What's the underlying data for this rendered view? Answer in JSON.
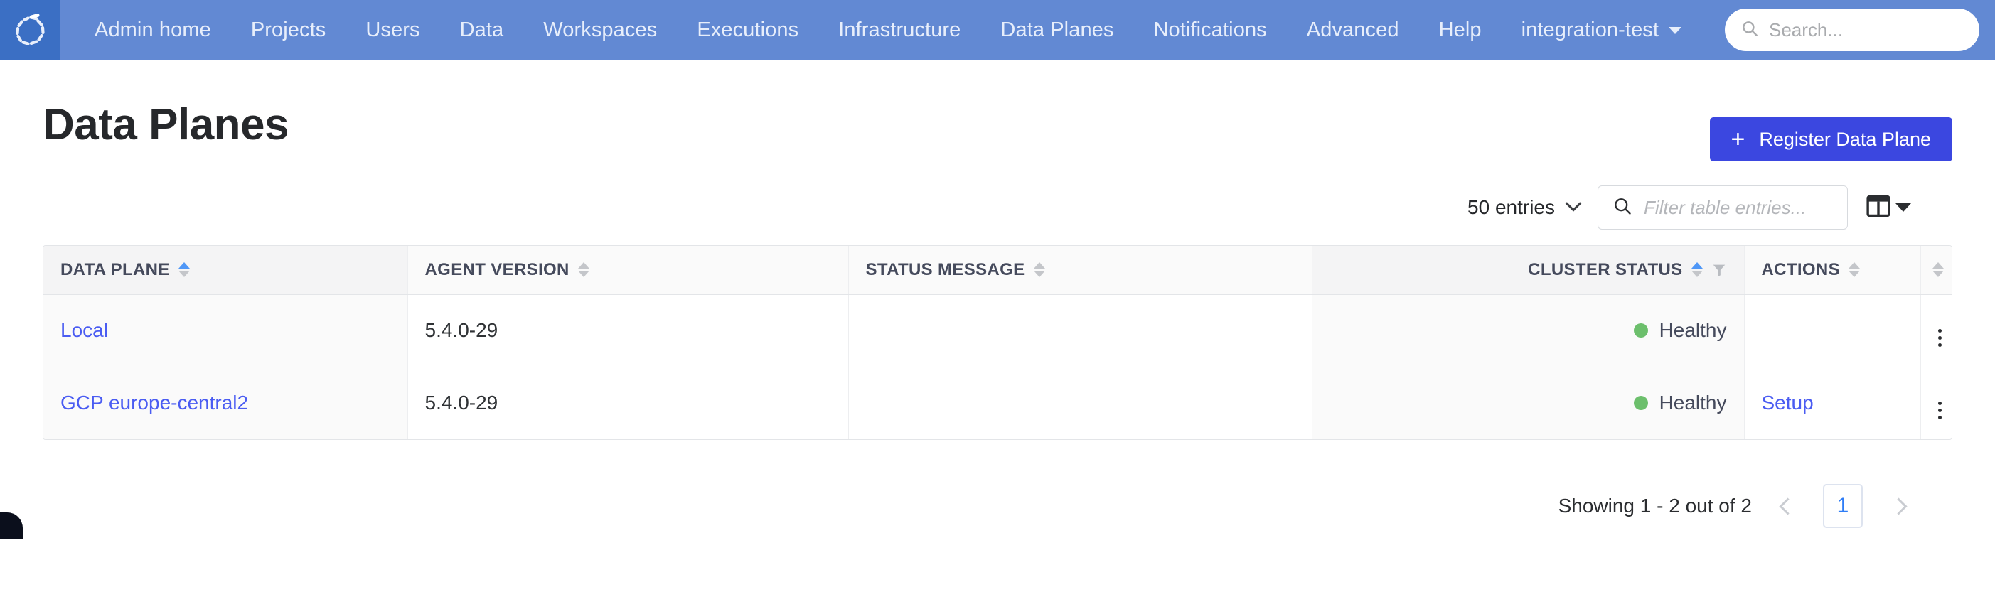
{
  "navbar": {
    "logo_icon": "seqera-spinner-logo",
    "items": [
      {
        "label": "Admin home",
        "caret": false
      },
      {
        "label": "Projects",
        "caret": false
      },
      {
        "label": "Users",
        "caret": false
      },
      {
        "label": "Data",
        "caret": false
      },
      {
        "label": "Workspaces",
        "caret": false
      },
      {
        "label": "Executions",
        "caret": false
      },
      {
        "label": "Infrastructure",
        "caret": false
      },
      {
        "label": "Data Planes",
        "caret": false
      },
      {
        "label": "Notifications",
        "caret": false
      },
      {
        "label": "Advanced",
        "caret": false
      },
      {
        "label": "Help",
        "caret": false
      },
      {
        "label": "integration-test",
        "caret": true
      }
    ],
    "search": {
      "placeholder": "Search...",
      "value": "",
      "icon": "search-icon"
    }
  },
  "header": {
    "title": "Data Planes",
    "register_button": {
      "label": "Register Data Plane",
      "icon": "plus-icon"
    }
  },
  "toolbar": {
    "entries": {
      "label": "50 entries",
      "icon": "chevron-down-icon"
    },
    "filter": {
      "placeholder": "Filter table entries...",
      "value": "",
      "icon": "search-icon"
    },
    "columns_button": {
      "icon": "columns-settings-icon"
    }
  },
  "table": {
    "columns": [
      {
        "key": "data_plane",
        "label": "DATA PLANE",
        "align": "left",
        "sort": "asc",
        "sorted": true,
        "filter": false
      },
      {
        "key": "agent_version",
        "label": "AGENT VERSION",
        "align": "left",
        "sort": "none",
        "sorted": false,
        "filter": false
      },
      {
        "key": "status_message",
        "label": "STATUS MESSAGE",
        "align": "left",
        "sort": "none",
        "sorted": false,
        "filter": false
      },
      {
        "key": "cluster_status",
        "label": "CLUSTER STATUS",
        "align": "right",
        "sort": "asc",
        "sorted": true,
        "filter": true
      },
      {
        "key": "actions",
        "label": "ACTIONS",
        "align": "left",
        "sort": "none",
        "sorted": false,
        "filter": false
      },
      {
        "key": "menu",
        "label": "",
        "align": "center",
        "sort": "none",
        "sorted": false,
        "filter": false
      }
    ],
    "rows": [
      {
        "data_plane": "Local",
        "agent_version": "5.4.0-29",
        "status_message": "",
        "cluster_status": "Healthy",
        "cluster_status_color": "#6cbf6c",
        "actions": "",
        "menu_icon": "kebab-menu-icon"
      },
      {
        "data_plane": "GCP europe-central2",
        "agent_version": "5.4.0-29",
        "status_message": "",
        "cluster_status": "Healthy",
        "cluster_status_color": "#6cbf6c",
        "actions": "Setup",
        "menu_icon": "kebab-menu-icon"
      }
    ]
  },
  "pagination": {
    "showing": "Showing 1 - 2 out of 2",
    "prev_icon": "chevron-left-icon",
    "next_icon": "chevron-right-icon",
    "pages": [
      "1"
    ],
    "current_page": "1"
  },
  "colors": {
    "navbar_bg": "#6289d3",
    "logo_bg": "#3b6fc4",
    "primary_button": "#3b47e0",
    "link": "#4a5cf2",
    "status_healthy": "#6cbf6c",
    "sort_active": "#4f97f7"
  }
}
